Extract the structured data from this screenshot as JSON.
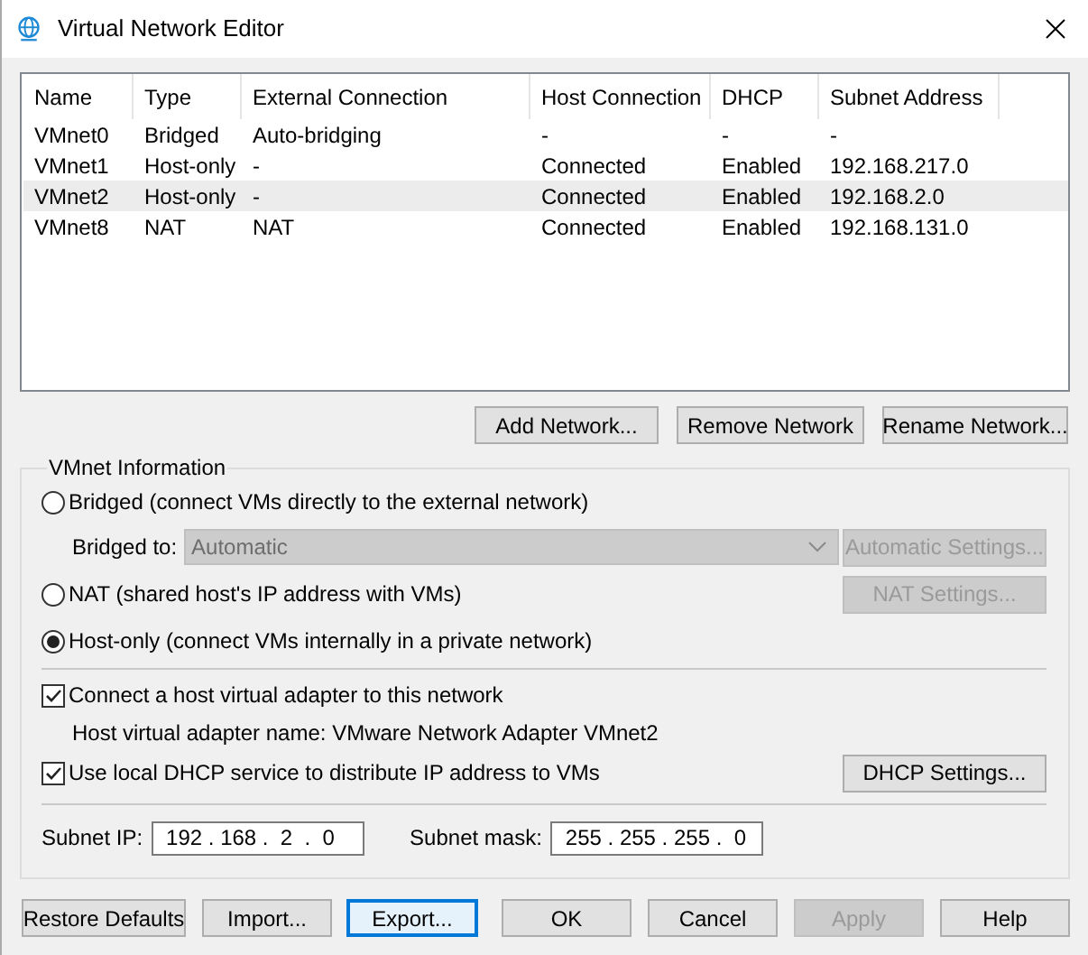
{
  "window": {
    "title": "Virtual Network Editor"
  },
  "table": {
    "columns": [
      "Name",
      "Type",
      "External Connection",
      "Host Connection",
      "DHCP",
      "Subnet Address"
    ],
    "rows": [
      {
        "cells": [
          "VMnet0",
          "Bridged",
          "Auto-bridging",
          "-",
          "-",
          "-"
        ],
        "selected": false
      },
      {
        "cells": [
          "VMnet1",
          "Host-only",
          "-",
          "Connected",
          "Enabled",
          "192.168.217.0"
        ],
        "selected": false
      },
      {
        "cells": [
          "VMnet2",
          "Host-only",
          "-",
          "Connected",
          "Enabled",
          "192.168.2.0"
        ],
        "selected": true
      },
      {
        "cells": [
          "VMnet8",
          "NAT",
          "NAT",
          "Connected",
          "Enabled",
          "192.168.131.0"
        ],
        "selected": false
      }
    ]
  },
  "network_buttons": [
    "Add Network...",
    "Remove Network",
    "Rename Network..."
  ],
  "vmnet_information": {
    "title": "VMnet Information",
    "options": [
      {
        "label": "Bridged (connect VMs directly to the external network)",
        "selected": false
      },
      {
        "label": "NAT (shared host's IP address with VMs)",
        "selected": false
      },
      {
        "label": "Host-only (connect VMs internally in a private network)",
        "selected": true
      }
    ],
    "bridged_to": {
      "label": "Bridged to:",
      "value": "Automatic",
      "disabled": true
    },
    "automatic_settings_button": {
      "label": "Automatic Settings...",
      "disabled": true
    },
    "nat_settings_button": {
      "label": "NAT Settings...",
      "disabled": true
    },
    "connect_adapter": {
      "label": "Connect a host virtual adapter to this network",
      "checked": true
    },
    "adapter_name": "Host virtual adapter name: VMware Network Adapter VMnet2",
    "use_dhcp": {
      "label": "Use local DHCP service to distribute IP address to VMs",
      "checked": true
    },
    "dhcp_settings_button": {
      "label": "DHCP Settings...",
      "disabled": false
    },
    "subnet_ip": {
      "label": "Subnet IP:",
      "value": "192 . 168 .  2  .  0"
    },
    "subnet_mask": {
      "label": "Subnet mask:",
      "value": "255 . 255 . 255 .  0"
    }
  },
  "footer_buttons": [
    {
      "label": "Restore Defaults",
      "disabled": false,
      "focused": false
    },
    {
      "label": "Import...",
      "disabled": false,
      "focused": false
    },
    {
      "label": "Export...",
      "disabled": false,
      "focused": true
    },
    {
      "label": "OK",
      "disabled": false,
      "focused": false
    },
    {
      "label": "Cancel",
      "disabled": false,
      "focused": false
    },
    {
      "label": "Apply",
      "disabled": true,
      "focused": false
    },
    {
      "label": "Help",
      "disabled": false,
      "focused": false
    }
  ]
}
